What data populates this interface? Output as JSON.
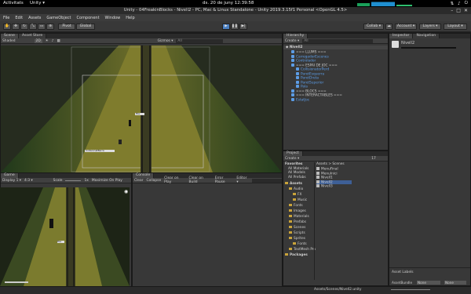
{
  "topbar": {
    "activities": "Activitats",
    "app": "Unity ▾",
    "clock": "ds. 20 de juny   12:39:58",
    "sys_icons": [
      "network-icon",
      "volume-icon",
      "power-icon"
    ]
  },
  "window": {
    "title": "Unity - 04FreakinBlocks - Nivell2 - PC, Mac & Linux Standalone - Unity 2019.3.15f1 Personal <OpenGL 4.5>"
  },
  "menu": [
    "File",
    "Edit",
    "Assets",
    "GameObject",
    "Component",
    "Window",
    "Help"
  ],
  "toolbar": {
    "pivot": "Pivot",
    "global": "Global",
    "collab": "Collab ▾",
    "account": "Account ▾",
    "layers": "Layers ▾",
    "layout": "Layout ▾"
  },
  "scene": {
    "tabs": [
      "Scene",
      "Asset Store"
    ],
    "shading": "Shaded",
    "mode_2d": "2D",
    "gizmos": "Gizmos ▾",
    "search_placeholder": "All",
    "labels": [
      "Fila",
      "CollisionatBarra"
    ]
  },
  "hierarchy": {
    "tab": "Hierarchy",
    "create": "Create ▾",
    "search_placeholder": "All",
    "scene_name": "Nivell2",
    "rows": [
      {
        "text": "=== LLUMS ===",
        "blue": false,
        "indent": 1
      },
      {
        "text": "CarregadorEscenes",
        "blue": true,
        "indent": 1
      },
      {
        "text": "Controlador",
        "blue": true,
        "indent": 1
      },
      {
        "text": "=== ESPAI DE JOC ===",
        "blue": false,
        "indent": 1
      },
      {
        "text": "CollisionatorPerd",
        "blue": true,
        "indent": 2
      },
      {
        "text": "ParetEsquerra",
        "blue": true,
        "indent": 2
      },
      {
        "text": "ParetDreta",
        "blue": true,
        "indent": 2
      },
      {
        "text": "ParetSuperior",
        "blue": true,
        "indent": 2
      },
      {
        "text": "Pala",
        "blue": true,
        "indent": 2
      },
      {
        "text": "=== BLOCS ===",
        "blue": false,
        "indent": 1
      },
      {
        "text": "=== INTERACTABLES ===",
        "blue": false,
        "indent": 1
      },
      {
        "text": "EstatJoc",
        "blue": true,
        "indent": 1
      }
    ]
  },
  "inspector": {
    "tabs": [
      "Inspector",
      "Navigation"
    ],
    "object": "Nivell2",
    "asset_labels": "Asset Labels",
    "assetbundle": "AssetBundle",
    "none1": "None",
    "none2": "None"
  },
  "project": {
    "tab": "Project",
    "create": "Create ▾",
    "count": "17",
    "favorites": [
      "Favorites",
      "All Materials",
      "All Models",
      "All Prefabs"
    ],
    "assets_tree": [
      {
        "text": "Assets",
        "indent": 0,
        "bold": true
      },
      {
        "text": "Audio",
        "indent": 1
      },
      {
        "text": "FX",
        "indent": 2
      },
      {
        "text": "Music",
        "indent": 2
      },
      {
        "text": "Fonts",
        "indent": 1
      },
      {
        "text": "Images",
        "indent": 1
      },
      {
        "text": "Materials",
        "indent": 1
      },
      {
        "text": "Prefabs",
        "indent": 1
      },
      {
        "text": "Scenes",
        "indent": 1
      },
      {
        "text": "Scripts",
        "indent": 1
      },
      {
        "text": "Sprites",
        "indent": 1
      },
      {
        "text": "Fonts",
        "indent": 2
      },
      {
        "text": "TextMesh Pro",
        "indent": 1
      },
      {
        "text": "Packages",
        "indent": 0,
        "bold": true
      }
    ],
    "breadcrumb": "Assets  >  Scenes",
    "scene_files": [
      "MenuFinal",
      "MenuInici",
      "Nivell1",
      "Nivell2",
      "Nivell3"
    ],
    "status_path": "Assets/Scenes/Nivell2.unity"
  },
  "game": {
    "tab": "Game",
    "display": "Display 1 ▾",
    "aspect": "4:3 ▾",
    "scale_label": "Scale",
    "scale_value": "1x",
    "maximize": "Maximize On Play",
    "label": "Fila"
  },
  "console": {
    "tab": "Console",
    "buttons": [
      "Clear",
      "Collapse",
      "Clear on Play",
      "Clear on Build",
      "Error Pause",
      "Editor ▾"
    ]
  }
}
